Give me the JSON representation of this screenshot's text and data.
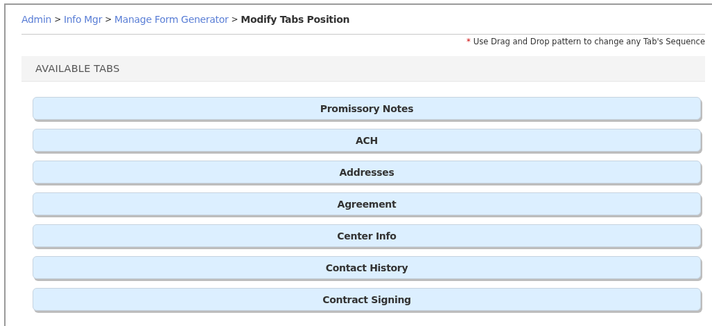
{
  "breadcrumb": [
    {
      "label": "Admin",
      "kind": "link"
    },
    {
      "label": ">",
      "kind": "separator"
    },
    {
      "label": "Info Mgr",
      "kind": "link"
    },
    {
      "label": ">",
      "kind": "separator"
    },
    {
      "label": "Manage Form Generator",
      "kind": "link"
    },
    {
      "label": ">",
      "kind": "separator"
    },
    {
      "label": "Modify Tabs Position",
      "kind": "current"
    }
  ],
  "note": {
    "marker": "*",
    "text": "Use Drag and Drop pattern to change any Tab's Sequence"
  },
  "section_title": "AVAILABLE TABS",
  "tabs": [
    "Promissory Notes",
    "ACH",
    "Addresses",
    "Agreement",
    "Center Info",
    "Contact History",
    "Contract Signing"
  ]
}
